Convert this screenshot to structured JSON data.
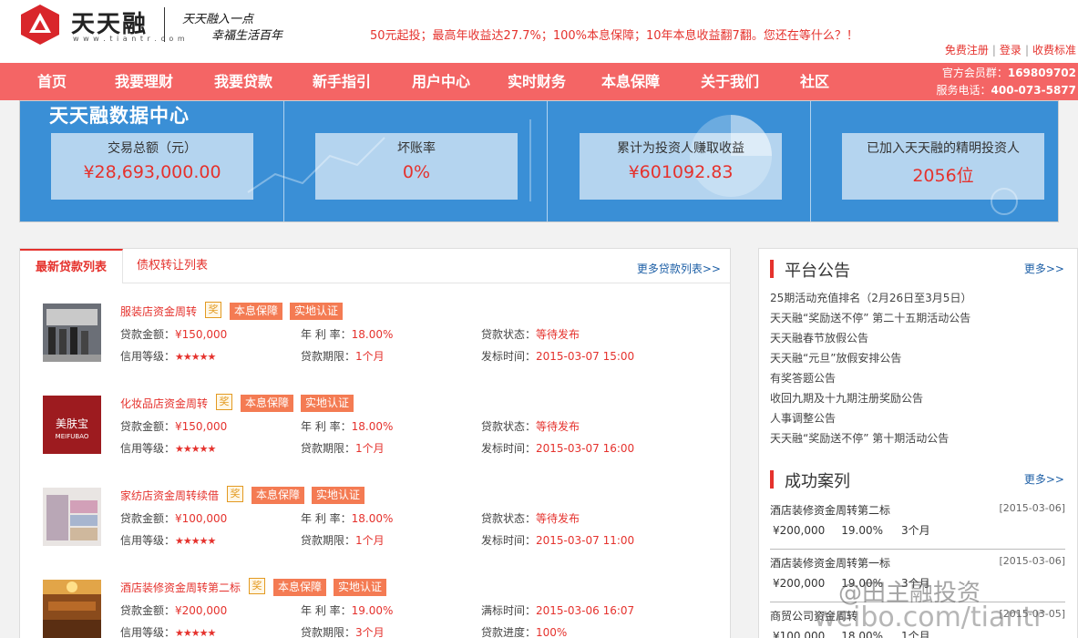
{
  "header": {
    "brand": "天天融",
    "brand_url": "w w w . t i a n t r . c o m",
    "slogan_line1": "天天融入一点",
    "slogan_line2": "幸福生活百年",
    "promo": "50元起投；最高年收益达27.7%；100%本息保障；10年本息收益翻7翻。您还在等什么？！",
    "links": [
      "免费注册",
      "登录",
      "收费标准"
    ]
  },
  "nav": {
    "items": [
      "首页",
      "我要理财",
      "我要贷款",
      "新手指引",
      "用户中心",
      "实时财务",
      "本息保障",
      "关于我们",
      "社区"
    ],
    "group_label": "官方会员群：",
    "group_value": "169809702",
    "phone_label": "服务电话：",
    "phone_value": "400-073-5877"
  },
  "datacenter": {
    "title": "天天融数据中心",
    "stats": [
      {
        "label": "交易总额（元）",
        "value": "¥28,693,000.00"
      },
      {
        "label": "坏账率",
        "value": "0%"
      },
      {
        "label": "累计为投资人赚取收益",
        "value": "¥601092.83"
      },
      {
        "label": "已加入天天融的精明投资人",
        "value": "2056位"
      }
    ]
  },
  "loans": {
    "tab_active": "最新贷款列表",
    "tab_other": "债权转让列表",
    "more": "更多贷款列表>>",
    "tag_jiang": "奖",
    "tag_baozhang": "本息保障",
    "tag_renzheng": "实地认证",
    "stars": "★★★★★",
    "label_amount": "贷款金额：",
    "label_rate": "年 利 率：",
    "label_credit": "信用等级：",
    "label_term": "贷款期限：",
    "items": [
      {
        "title": "服装店资金周转",
        "amount": "¥150,000",
        "rate": "18.00%",
        "term": "1个月",
        "status_label": "贷款状态：",
        "status": "等待发布",
        "time_label": "发标时间：",
        "time": "2015-03-07 15:00"
      },
      {
        "title": "化妆品店资金周转",
        "amount": "¥150,000",
        "rate": "18.00%",
        "term": "1个月",
        "status_label": "贷款状态：",
        "status": "等待发布",
        "time_label": "发标时间：",
        "time": "2015-03-07 16:00",
        "thumb_text": "美肤宝",
        "thumb_sub": "MEIFUBAO"
      },
      {
        "title": "家纺店资金周转续借",
        "amount": "¥100,000",
        "rate": "18.00%",
        "term": "1个月",
        "status_label": "贷款状态：",
        "status": "等待发布",
        "time_label": "发标时间：",
        "time": "2015-03-07 11:00"
      },
      {
        "title": "酒店装修资金周转第二标",
        "amount": "¥200,000",
        "rate": "19.00%",
        "term": "3个月",
        "status_label": "满标时间：",
        "status": "2015-03-06 16:07",
        "time_label": "贷款进度：",
        "time": "100%"
      }
    ]
  },
  "notices": {
    "title": "平台公告",
    "more": "更多>>",
    "items": [
      "25期活动充值排名（2月26日至3月5日）",
      "天天融“奖励送不停” 第二十五期活动公告",
      "天天融春节放假公告",
      "天天融“元旦”放假安排公告",
      "有奖答题公告",
      "收回九期及十九期注册奖励公告",
      "人事调整公告",
      "天天融“奖励送不停” 第十期活动公告"
    ]
  },
  "cases": {
    "title": "成功案列",
    "more": "更多>>",
    "items": [
      {
        "title": "酒店装修资金周转第二标",
        "date": "[2015-03-06]",
        "amount": "¥200,000",
        "rate": "19.00%",
        "term": "3个月"
      },
      {
        "title": "酒店装修资金周转第一标",
        "date": "[2015-03-06]",
        "amount": "¥200,000",
        "rate": "19.00%",
        "term": "3个月"
      },
      {
        "title": "商贸公司资金周转",
        "date": "[2015-03-05]",
        "amount": "¥100,000",
        "rate": "18.00%",
        "term": "1个月"
      }
    ]
  },
  "watermark": {
    "line1": "@田主融投资",
    "line2": "weibo.com/tiantr"
  },
  "colors": {
    "accent": "#e5322d",
    "nav": "#f46565",
    "datacenter": "#3a8fd6",
    "link": "#1d5fa6"
  }
}
